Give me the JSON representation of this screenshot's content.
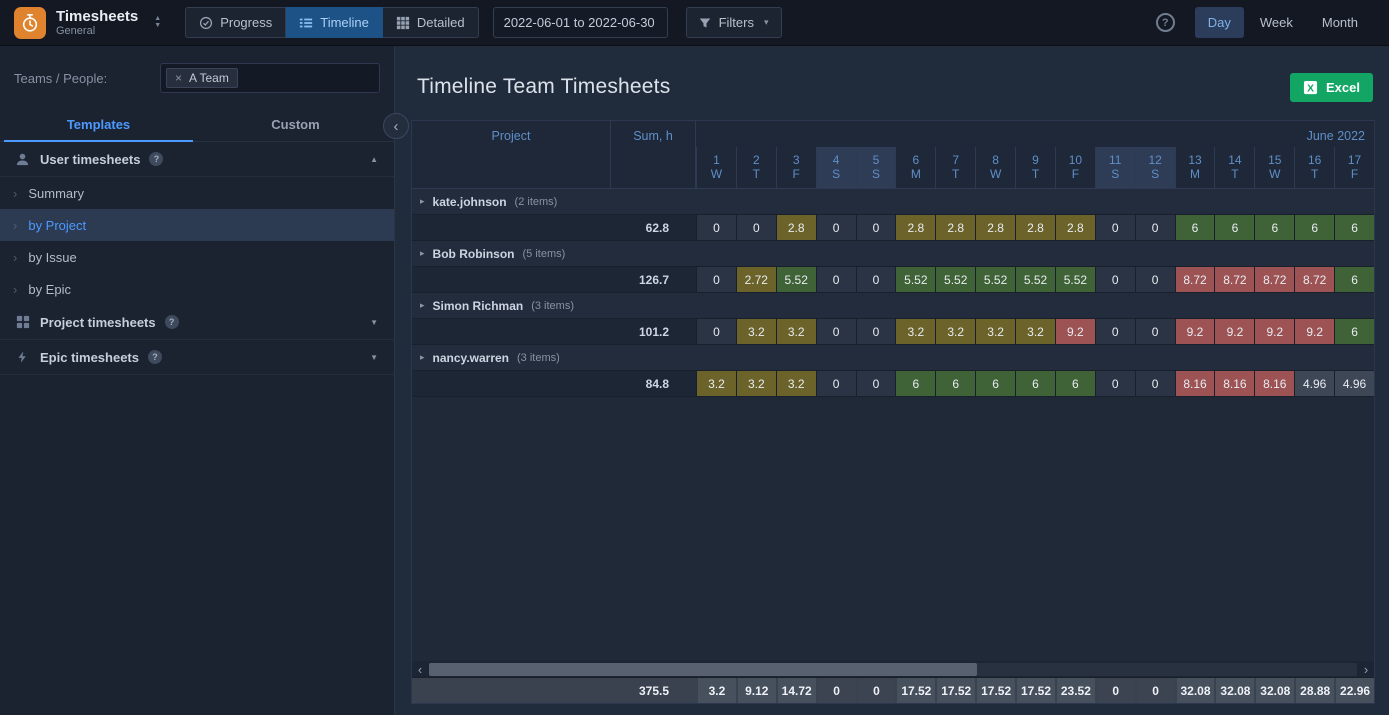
{
  "colors": {
    "accent": "#4c9aff",
    "excel_green": "#12a563",
    "cell_olive": "#6b6329",
    "cell_green": "#3f6236",
    "cell_red": "#9d5353",
    "cell_dim": "#3e4756",
    "weekend_header": "#2e3c55"
  },
  "topbar": {
    "app_title": "Timesheets",
    "app_subtitle": "General",
    "views": [
      {
        "label": "Progress",
        "icon": "progress-icon",
        "active": false
      },
      {
        "label": "Timeline",
        "icon": "timeline-icon",
        "active": true
      },
      {
        "label": "Detailed",
        "icon": "detailed-icon",
        "active": false
      }
    ],
    "date_range": "2022-06-01 to 2022-06-30",
    "filters_label": "Filters",
    "zoom_levels": [
      {
        "label": "Day",
        "active": true
      },
      {
        "label": "Week",
        "active": false
      },
      {
        "label": "Month",
        "active": false
      }
    ]
  },
  "sidebar": {
    "teams_label": "Teams / People:",
    "team_chip": {
      "remove": "×",
      "label": "A Team"
    },
    "tabs": [
      {
        "label": "Templates",
        "active": true
      },
      {
        "label": "Custom",
        "active": false
      }
    ],
    "sections": [
      {
        "id": "user",
        "label": "User timesheets",
        "icon": "user-icon",
        "expanded": true,
        "items": [
          {
            "label": "Summary",
            "active": false
          },
          {
            "label": "by Project",
            "active": true
          },
          {
            "label": "by Issue",
            "active": false
          },
          {
            "label": "by Epic",
            "active": false
          }
        ]
      },
      {
        "id": "project",
        "label": "Project timesheets",
        "icon": "grid-icon",
        "expanded": false,
        "items": []
      },
      {
        "id": "epic",
        "label": "Epic timesheets",
        "icon": "epic-icon",
        "expanded": false,
        "items": []
      }
    ]
  },
  "main": {
    "title": "Timeline Team Timesheets",
    "excel_label": "Excel"
  },
  "table": {
    "project_header": "Project",
    "sum_header": "Sum, h",
    "month_label": "June 2022",
    "days": [
      {
        "num": "1",
        "dow": "W",
        "weekend": false
      },
      {
        "num": "2",
        "dow": "T",
        "weekend": false
      },
      {
        "num": "3",
        "dow": "F",
        "weekend": false
      },
      {
        "num": "4",
        "dow": "S",
        "weekend": true
      },
      {
        "num": "5",
        "dow": "S",
        "weekend": true
      },
      {
        "num": "6",
        "dow": "M",
        "weekend": false
      },
      {
        "num": "7",
        "dow": "T",
        "weekend": false
      },
      {
        "num": "8",
        "dow": "W",
        "weekend": false
      },
      {
        "num": "9",
        "dow": "T",
        "weekend": false
      },
      {
        "num": "10",
        "dow": "F",
        "weekend": false
      },
      {
        "num": "11",
        "dow": "S",
        "weekend": true
      },
      {
        "num": "12",
        "dow": "S",
        "weekend": true
      },
      {
        "num": "13",
        "dow": "M",
        "weekend": false
      },
      {
        "num": "14",
        "dow": "T",
        "weekend": false
      },
      {
        "num": "15",
        "dow": "W",
        "weekend": false
      },
      {
        "num": "16",
        "dow": "T",
        "weekend": false
      },
      {
        "num": "17",
        "dow": "F",
        "weekend": false
      }
    ],
    "groups": [
      {
        "name": "kate.johnson",
        "items_label": "(2 items)",
        "sum": "62.8",
        "cells": [
          {
            "v": "0",
            "c": "zero"
          },
          {
            "v": "0",
            "c": "zero"
          },
          {
            "v": "2.8",
            "c": "olive"
          },
          {
            "v": "0",
            "c": "zero"
          },
          {
            "v": "0",
            "c": "zero"
          },
          {
            "v": "2.8",
            "c": "olive"
          },
          {
            "v": "2.8",
            "c": "olive"
          },
          {
            "v": "2.8",
            "c": "olive"
          },
          {
            "v": "2.8",
            "c": "olive"
          },
          {
            "v": "2.8",
            "c": "olive"
          },
          {
            "v": "0",
            "c": "zero"
          },
          {
            "v": "0",
            "c": "zero"
          },
          {
            "v": "6",
            "c": "green"
          },
          {
            "v": "6",
            "c": "green"
          },
          {
            "v": "6",
            "c": "green"
          },
          {
            "v": "6",
            "c": "green"
          },
          {
            "v": "6",
            "c": "green"
          }
        ]
      },
      {
        "name": "Bob Robinson",
        "items_label": "(5 items)",
        "sum": "126.7",
        "cells": [
          {
            "v": "0",
            "c": "zero"
          },
          {
            "v": "2.72",
            "c": "olive"
          },
          {
            "v": "5.52",
            "c": "green"
          },
          {
            "v": "0",
            "c": "zero"
          },
          {
            "v": "0",
            "c": "zero"
          },
          {
            "v": "5.52",
            "c": "green"
          },
          {
            "v": "5.52",
            "c": "green"
          },
          {
            "v": "5.52",
            "c": "green"
          },
          {
            "v": "5.52",
            "c": "green"
          },
          {
            "v": "5.52",
            "c": "green"
          },
          {
            "v": "0",
            "c": "zero"
          },
          {
            "v": "0",
            "c": "zero"
          },
          {
            "v": "8.72",
            "c": "red"
          },
          {
            "v": "8.72",
            "c": "red"
          },
          {
            "v": "8.72",
            "c": "red"
          },
          {
            "v": "8.72",
            "c": "red"
          },
          {
            "v": "6",
            "c": "green"
          }
        ]
      },
      {
        "name": "Simon Richman",
        "items_label": "(3 items)",
        "sum": "101.2",
        "cells": [
          {
            "v": "0",
            "c": "zero"
          },
          {
            "v": "3.2",
            "c": "olive"
          },
          {
            "v": "3.2",
            "c": "olive"
          },
          {
            "v": "0",
            "c": "zero"
          },
          {
            "v": "0",
            "c": "zero"
          },
          {
            "v": "3.2",
            "c": "olive"
          },
          {
            "v": "3.2",
            "c": "olive"
          },
          {
            "v": "3.2",
            "c": "olive"
          },
          {
            "v": "3.2",
            "c": "olive"
          },
          {
            "v": "9.2",
            "c": "red"
          },
          {
            "v": "0",
            "c": "zero"
          },
          {
            "v": "0",
            "c": "zero"
          },
          {
            "v": "9.2",
            "c": "red"
          },
          {
            "v": "9.2",
            "c": "red"
          },
          {
            "v": "9.2",
            "c": "red"
          },
          {
            "v": "9.2",
            "c": "red"
          },
          {
            "v": "6",
            "c": "green"
          }
        ]
      },
      {
        "name": "nancy.warren",
        "items_label": "(3 items)",
        "sum": "84.8",
        "cells": [
          {
            "v": "3.2",
            "c": "olive"
          },
          {
            "v": "3.2",
            "c": "olive"
          },
          {
            "v": "3.2",
            "c": "olive"
          },
          {
            "v": "0",
            "c": "zero"
          },
          {
            "v": "0",
            "c": "zero"
          },
          {
            "v": "6",
            "c": "green"
          },
          {
            "v": "6",
            "c": "green"
          },
          {
            "v": "6",
            "c": "green"
          },
          {
            "v": "6",
            "c": "green"
          },
          {
            "v": "6",
            "c": "green"
          },
          {
            "v": "0",
            "c": "zero"
          },
          {
            "v": "0",
            "c": "zero"
          },
          {
            "v": "8.16",
            "c": "red"
          },
          {
            "v": "8.16",
            "c": "red"
          },
          {
            "v": "8.16",
            "c": "red"
          },
          {
            "v": "4.96",
            "c": "dim"
          },
          {
            "v": "4.96",
            "c": "dim"
          }
        ]
      }
    ],
    "footer": {
      "sum": "375.5",
      "cells": [
        "3.2",
        "9.12",
        "14.72",
        "0",
        "0",
        "17.52",
        "17.52",
        "17.52",
        "17.52",
        "23.52",
        "0",
        "0",
        "32.08",
        "32.08",
        "32.08",
        "28.88",
        "22.96"
      ]
    }
  }
}
